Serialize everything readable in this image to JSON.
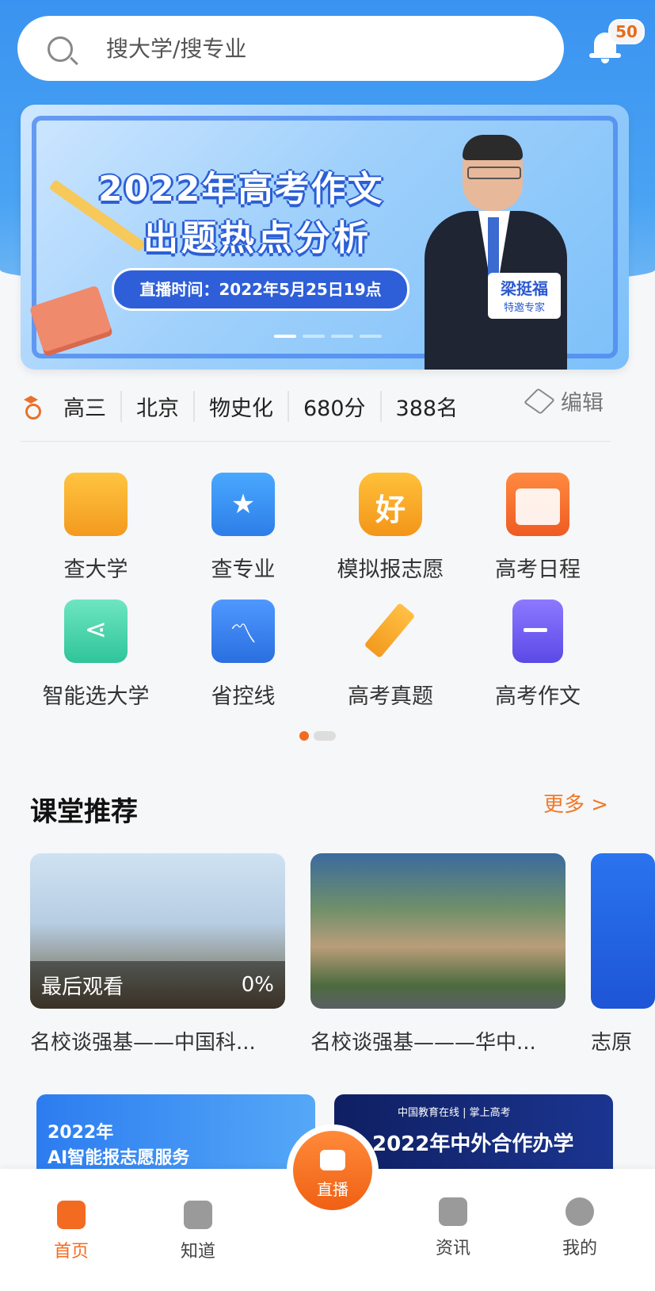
{
  "search": {
    "placeholder": "搜大学/搜专业"
  },
  "notifications": {
    "count": "50"
  },
  "banner": {
    "title_line1": "2022年高考作文",
    "title_line2": "出题热点分析",
    "live_time": "直播时间：2022年5月25日19点",
    "speaker_name": "梁挺福",
    "speaker_role": "特邀专家",
    "page_indicator": {
      "total": 4,
      "active": 1
    }
  },
  "profile": {
    "grade": "高三",
    "region": "北京",
    "subjects": "物史化",
    "score": "680分",
    "rank": "388名",
    "edit_label": "编辑"
  },
  "quick_menu": [
    {
      "label": "查大学",
      "icon": "school-building-icon",
      "color": "#f6a623"
    },
    {
      "label": "查专业",
      "icon": "star-book-icon",
      "color": "#2d8ff0"
    },
    {
      "label": "模拟报志愿",
      "icon": "good-badge-icon",
      "glyph": "好",
      "color": "#f7a21c"
    },
    {
      "label": "高考日程",
      "icon": "calendar-icon",
      "color": "#f4692a"
    },
    {
      "label": "智能选大学",
      "icon": "share-folder-icon",
      "color": "#3fd1a7"
    },
    {
      "label": "省控线",
      "icon": "line-chart-icon",
      "color": "#3d86ee"
    },
    {
      "label": "高考真题",
      "icon": "pencil-icon",
      "color": "#f6a32a"
    },
    {
      "label": "高考作文",
      "icon": "document-icon",
      "color": "#6d5ef0"
    }
  ],
  "quick_menu_pages": {
    "total": 2,
    "active": 1
  },
  "recommend": {
    "title": "课堂推荐",
    "more_label": "更多 >",
    "cards": [
      {
        "caption": "名校谈强基——中国科...",
        "overlay_left": "最后观看",
        "overlay_right": "0%"
      },
      {
        "caption": "名校谈强基———华中..."
      },
      {
        "caption": "志原"
      }
    ]
  },
  "promos": [
    {
      "line1": "2022年",
      "line2": "AI智能报志愿服务"
    },
    {
      "brand": "中国教育在线 | 掌上高考",
      "line1": "2022年中外合作办学"
    }
  ],
  "tabbar": [
    {
      "label": "首页",
      "active": true
    },
    {
      "label": "知道",
      "active": false
    },
    {
      "label": "直播",
      "active": false
    },
    {
      "label": "资讯",
      "active": false
    },
    {
      "label": "我的",
      "active": false
    }
  ],
  "colors": {
    "primary": "#3a93f0",
    "accent": "#f36b21"
  }
}
